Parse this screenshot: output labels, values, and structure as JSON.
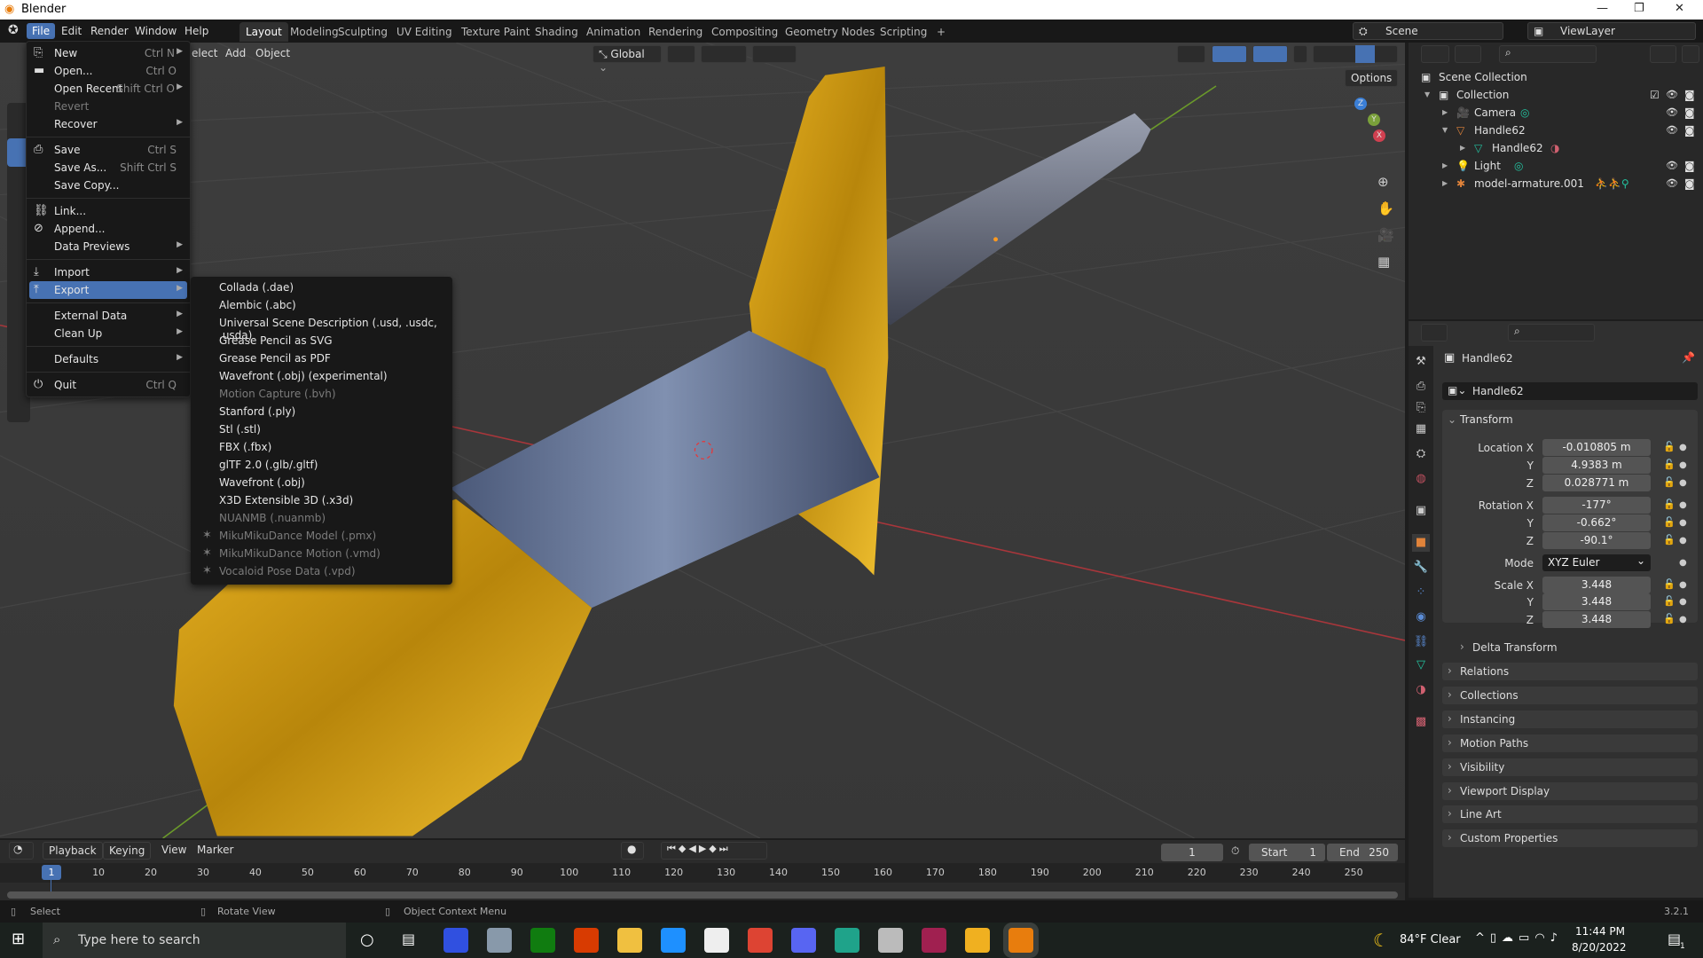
{
  "window": {
    "title": "Blender",
    "controls": [
      "—",
      "❐",
      "✕"
    ]
  },
  "topbar": {
    "menus": [
      "File",
      "Edit",
      "Render",
      "Window",
      "Help"
    ],
    "workspaces": [
      "Layout",
      "Modeling",
      "Sculpting",
      "UV Editing",
      "Texture Paint",
      "Shading",
      "Animation",
      "Rendering",
      "Compositing",
      "Geometry Nodes",
      "Scripting",
      "+"
    ],
    "active_workspace": "Layout",
    "scene": "Scene",
    "view_layer": "ViewLayer"
  },
  "viewport": {
    "menus": [
      "elect",
      "Add",
      "Object"
    ],
    "orientation": "Global",
    "options_label": "Options",
    "gizmo_axes": [
      "X",
      "Y",
      "Z"
    ],
    "colors": {
      "background": "#3a3a3a",
      "x_axis": "#b03a3f",
      "y_axis": "#6b9a2a",
      "gold": "#d9a520",
      "steel": "#5a6a8a"
    }
  },
  "file_menu": {
    "items": [
      {
        "label": "New",
        "shortcut": "Ctrl N",
        "icon": "new-file-icon",
        "submenu": true
      },
      {
        "label": "Open...",
        "shortcut": "Ctrl O",
        "icon": "folder-icon"
      },
      {
        "label": "Open Recent",
        "shortcut": "Shift Ctrl O",
        "submenu": true
      },
      {
        "label": "Revert",
        "disabled": true
      },
      {
        "label": "Recover",
        "submenu": true
      },
      {
        "sep": true
      },
      {
        "label": "Save",
        "shortcut": "Ctrl S",
        "icon": "save-icon"
      },
      {
        "label": "Save As...",
        "shortcut": "Shift Ctrl S"
      },
      {
        "label": "Save Copy..."
      },
      {
        "sep": true
      },
      {
        "label": "Link...",
        "icon": "link-icon"
      },
      {
        "label": "Append...",
        "icon": "paperclip-icon"
      },
      {
        "label": "Data Previews",
        "submenu": true
      },
      {
        "sep": true
      },
      {
        "label": "Import",
        "icon": "import-icon",
        "submenu": true
      },
      {
        "label": "Export",
        "icon": "export-icon",
        "submenu": true,
        "highlighted": true
      },
      {
        "sep": true
      },
      {
        "label": "External Data",
        "submenu": true
      },
      {
        "label": "Clean Up",
        "submenu": true
      },
      {
        "sep": true
      },
      {
        "label": "Defaults",
        "submenu": true
      },
      {
        "sep": true
      },
      {
        "label": "Quit",
        "shortcut": "Ctrl Q",
        "icon": "power-icon"
      }
    ]
  },
  "export_menu": {
    "items": [
      {
        "label": "Collada (.dae)"
      },
      {
        "label": "Alembic (.abc)"
      },
      {
        "label": "Universal Scene Description (.usd, .usdc, .usda)"
      },
      {
        "label": "Grease Pencil as SVG"
      },
      {
        "label": "Grease Pencil as PDF"
      },
      {
        "label": "Wavefront (.obj) (experimental)"
      },
      {
        "label": "Motion Capture (.bvh)",
        "disabled": true
      },
      {
        "label": "Stanford (.ply)"
      },
      {
        "label": "Stl (.stl)"
      },
      {
        "label": "FBX (.fbx)"
      },
      {
        "label": "glTF 2.0 (.glb/.gltf)"
      },
      {
        "label": "Wavefront (.obj)"
      },
      {
        "label": "X3D Extensible 3D (.x3d)"
      },
      {
        "label": "NUANMB (.nuanmb)",
        "disabled": true
      },
      {
        "label": "MikuMikuDance Model (.pmx)",
        "disabled": true,
        "icon": "mmd-icon"
      },
      {
        "label": "MikuMikuDance Motion (.vmd)",
        "disabled": true,
        "icon": "mmd-icon"
      },
      {
        "label": "Vocaloid Pose Data (.vpd)",
        "disabled": true,
        "icon": "mmd-icon"
      }
    ]
  },
  "outliner": {
    "rows": [
      {
        "label": "Scene Collection",
        "indent": 0,
        "icon": "scene-collection-icon",
        "color": "#dddddd"
      },
      {
        "label": "Collection",
        "indent": 1,
        "icon": "collection-icon",
        "expanded": true,
        "checkbox": true,
        "color": "#dddddd"
      },
      {
        "label": "Camera",
        "indent": 2,
        "icon": "camera-icon",
        "color": "#e0833a",
        "extra": "camera-data-icon"
      },
      {
        "label": "Handle62",
        "indent": 2,
        "icon": "mesh-object-icon",
        "expanded": true,
        "color": "#e0833a"
      },
      {
        "label": "Handle62",
        "indent": 3,
        "icon": "mesh-data-icon",
        "color": "#23c3a0",
        "extra": "material-icon",
        "no_vis": true
      },
      {
        "label": "Light",
        "indent": 2,
        "icon": "light-icon",
        "color": "#e0833a",
        "extra": "light-data-icon"
      },
      {
        "label": "model-armature.001",
        "indent": 2,
        "icon": "armature-icon",
        "color": "#e0833a",
        "extra": "pose-icons"
      }
    ]
  },
  "properties": {
    "object_name": "Handle62",
    "name_field": "Handle62",
    "transform_label": "Transform",
    "location": {
      "label": "Location X",
      "x": "-0.010805 m",
      "y": "4.9383 m",
      "z": "0.028771 m"
    },
    "rotation": {
      "label": "Rotation X",
      "x": "-177°",
      "y": "-0.662°",
      "z": "-90.1°"
    },
    "mode": {
      "label": "Mode",
      "value": "XYZ Euler"
    },
    "scale": {
      "label": "Scale X",
      "x": "3.448",
      "y": "3.448",
      "z": "3.448"
    },
    "axis_labels": [
      "Y",
      "Z"
    ],
    "sections": [
      "Delta Transform",
      "Relations",
      "Collections",
      "Instancing",
      "Motion Paths",
      "Visibility",
      "Viewport Display",
      "Line Art",
      "Custom Properties"
    ]
  },
  "timeline": {
    "menus": [
      "Playback",
      "Keying",
      "View",
      "Marker"
    ],
    "current_frame": "1",
    "start_label": "Start",
    "start": "1",
    "end_label": "End",
    "end": "250",
    "ticks": [
      "10",
      "20",
      "30",
      "40",
      "50",
      "60",
      "70",
      "80",
      "90",
      "100",
      "110",
      "120",
      "130",
      "140",
      "150",
      "160",
      "170",
      "180",
      "190",
      "200",
      "210",
      "220",
      "230",
      "240",
      "250"
    ],
    "playhead": "1"
  },
  "statusbar": {
    "select": "Select",
    "rotate": "Rotate View",
    "context": "Object Context Menu",
    "version": "3.2.1"
  },
  "taskbar": {
    "search_placeholder": "Type here to search",
    "weather": "84°F  Clear",
    "time": "11:44 PM",
    "date": "8/20/2022",
    "notifications": "1"
  }
}
